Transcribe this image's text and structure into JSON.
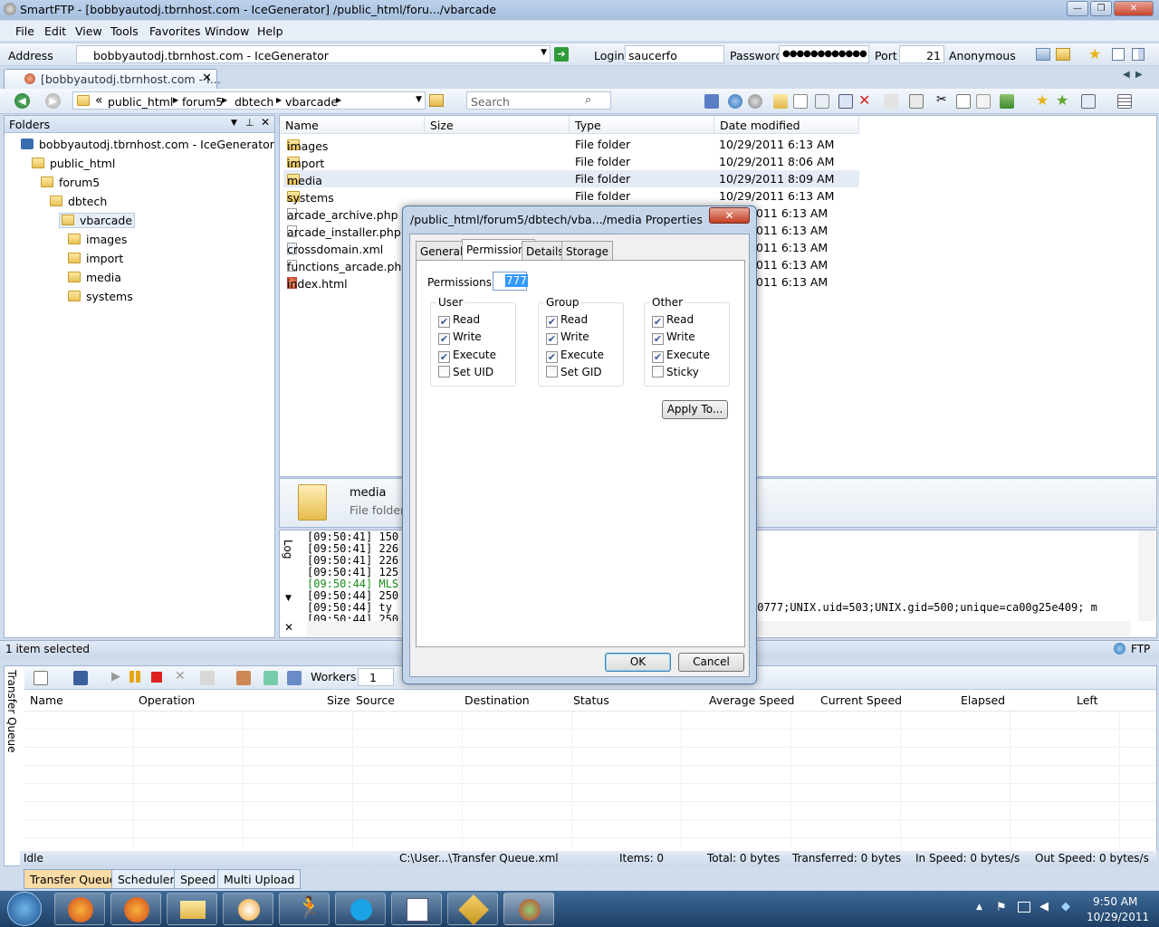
{
  "window": {
    "title": "SmartFTP - [bobbyautodj.tbrnhost.com - IceGenerator] /public_html/foru.../vbarcade",
    "controls": [
      "—",
      "❐",
      "✕"
    ]
  },
  "menu": [
    "File",
    "Edit",
    "View",
    "Tools",
    "Favorites",
    "Window",
    "Help"
  ],
  "addressbar": {
    "address_label": "Address",
    "address_value": "bobbyautodj.tbrnhost.com - IceGenerator",
    "login_label": "Login",
    "login_value": "saucerfo",
    "password_label": "Password",
    "password_value": "●●●●●●●●●●●●",
    "port_label": "Port",
    "port_value": "21",
    "anonymous_label": "Anonymous"
  },
  "doc_tab": {
    "label": "[bobbyautodj.tbrnhost.com - I..."
  },
  "breadcrumb": {
    "prefix": "«",
    "items": [
      "public_html",
      "forum5",
      "dbtech",
      "vbarcade"
    ]
  },
  "search": {
    "placeholder": "Search"
  },
  "folders_pane": {
    "title": "Folders",
    "tree": [
      {
        "label": "bobbyautodj.tbrnhost.com - IceGenerator",
        "level": 0
      },
      {
        "label": "public_html",
        "level": 1
      },
      {
        "label": "forum5",
        "level": 2
      },
      {
        "label": "dbtech",
        "level": 3
      },
      {
        "label": "vbarcade",
        "level": 4,
        "selected": true
      },
      {
        "label": "images",
        "level": 5
      },
      {
        "label": "import",
        "level": 5
      },
      {
        "label": "media",
        "level": 5
      },
      {
        "label": "systems",
        "level": 5
      }
    ]
  },
  "file_list": {
    "columns": [
      "Name",
      "Size",
      "Type",
      "Date modified"
    ],
    "rows": [
      {
        "name": "images",
        "type": "File folder",
        "date": "10/29/2011 6:13 AM",
        "kind": "folder"
      },
      {
        "name": "import",
        "type": "File folder",
        "date": "10/29/2011 8:06 AM",
        "kind": "folder"
      },
      {
        "name": "media",
        "type": "File folder",
        "date": "10/29/2011 8:09 AM",
        "kind": "folder",
        "selected": true
      },
      {
        "name": "systems",
        "type": "File folder",
        "date": "10/29/2011 6:13 AM",
        "kind": "folder"
      },
      {
        "name": "arcade_archive.php",
        "type": "",
        "date": "011 6:13 AM",
        "kind": "file"
      },
      {
        "name": "arcade_installer.php",
        "type": "",
        "date": "011 6:13 AM",
        "kind": "file"
      },
      {
        "name": "crossdomain.xml",
        "type": "",
        "date": "011 6:13 AM",
        "kind": "file"
      },
      {
        "name": "functions_arcade.php",
        "type": "",
        "date": "011 6:13 AM",
        "kind": "file"
      },
      {
        "name": "index.html",
        "type": "",
        "date": "011 6:13 AM",
        "kind": "file"
      }
    ]
  },
  "preview": {
    "name": "media",
    "type": "File folder"
  },
  "log": {
    "label": "Log",
    "lines": [
      "[09:50:41] 150",
      "[09:50:41] 226",
      "[09:50:41] 226",
      "[09:50:41] 125",
      "[09:50:44] MLS",
      "[09:50:44] 250",
      "[09:50:44]  ty",
      "[09:50:44] 250"
    ],
    "tail": "=0777;UNIX.uid=503;UNIX.gid=500;unique=ca00g25e409; m"
  },
  "status1": {
    "left": "1 item selected",
    "right": "FTP"
  },
  "queue": {
    "side_label": "Transfer Queue",
    "workers_label": "Workers",
    "workers_value": "1",
    "columns": [
      "Name",
      "Operation",
      "Size",
      "Source",
      "Destination",
      "Status",
      "Average Speed",
      "Current Speed",
      "Elapsed",
      "Left"
    ]
  },
  "status2": {
    "state": "Idle",
    "file": "C:\\User...\\Transfer Queue.xml",
    "items": "Items: 0",
    "total": "Total: 0 bytes",
    "transferred": "Transferred: 0 bytes",
    "in_speed": "In Speed: 0 bytes/s",
    "out_speed": "Out Speed: 0 bytes/s"
  },
  "bottom_tabs": [
    "Transfer Queue",
    "Scheduler",
    "Speed",
    "Multi Upload"
  ],
  "dialog": {
    "title": "/public_html/forum5/dbtech/vba.../media Properties",
    "tabs": [
      "General",
      "Permissions",
      "Details",
      "Storage"
    ],
    "permissions_label": "Permissions:",
    "permissions_value": "777",
    "groups": [
      {
        "title": "User",
        "items": [
          {
            "label": "Read",
            "checked": true
          },
          {
            "label": "Write",
            "checked": true
          },
          {
            "label": "Execute",
            "checked": true
          },
          {
            "label": "Set UID",
            "checked": false
          }
        ]
      },
      {
        "title": "Group",
        "items": [
          {
            "label": "Read",
            "checked": true
          },
          {
            "label": "Write",
            "checked": true
          },
          {
            "label": "Execute",
            "checked": true
          },
          {
            "label": "Set GID",
            "checked": false
          }
        ]
      },
      {
        "title": "Other",
        "items": [
          {
            "label": "Read",
            "checked": true
          },
          {
            "label": "Write",
            "checked": true
          },
          {
            "label": "Execute",
            "checked": true
          },
          {
            "label": "Sticky",
            "checked": false
          }
        ]
      }
    ],
    "apply_to": "Apply To...",
    "ok": "OK",
    "cancel": "Cancel"
  },
  "taskbar": {
    "time": "9:50 AM",
    "date": "10/29/2011"
  }
}
